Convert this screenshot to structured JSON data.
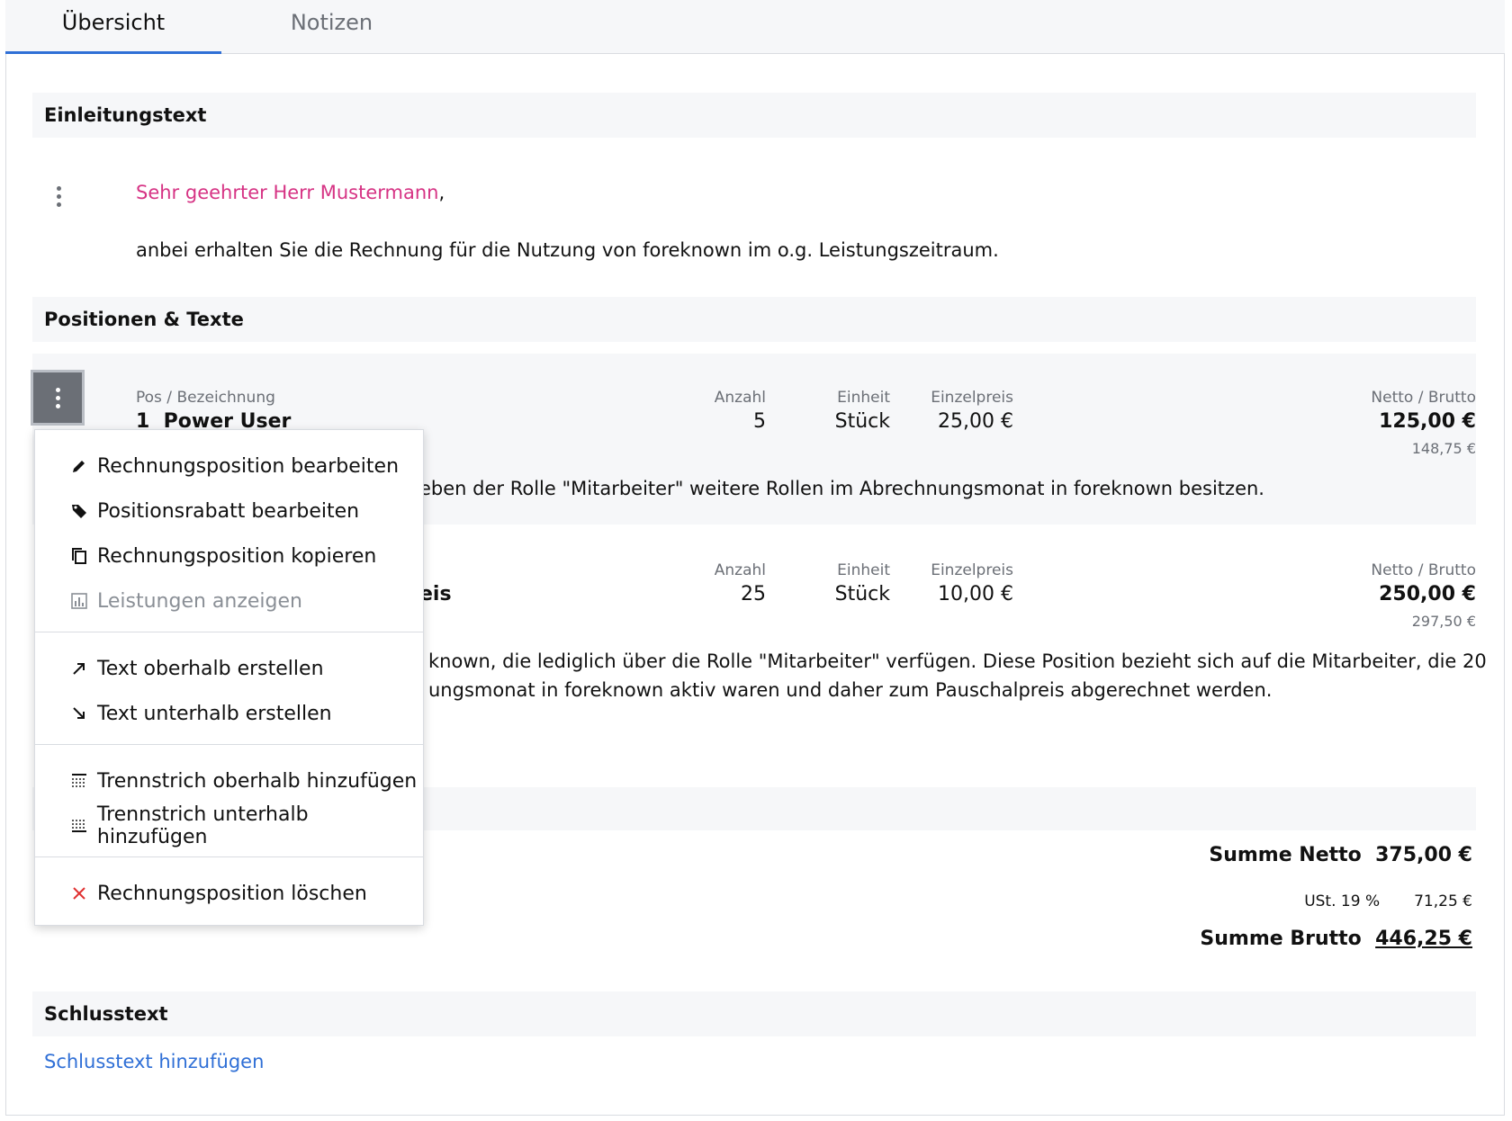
{
  "tabs": [
    {
      "label": "Übersicht"
    },
    {
      "label": "Notizen"
    }
  ],
  "intro_section": {
    "title": "Einleitungstext",
    "salutation_name": "Sehr geehrter Herr Mustermann",
    "salutation_punct": ",",
    "body": "anbei erhalten Sie die Rechnung für die Nutzung von foreknown im o.g. Leistungszeitraum."
  },
  "positions_section": {
    "title": "Positionen & Texte",
    "headers": {
      "pos": "Pos / Bezeichnung",
      "qty": "Anzahl",
      "unit": "Einheit",
      "price": "Einzelpreis",
      "total": "Netto / Brutto"
    },
    "items": [
      {
        "number": "1",
        "name": "Power User",
        "qty": "5",
        "unit": "Stück",
        "price": "25,00 €",
        "net": "125,00 €",
        "gross": "148,75 €",
        "desc_lines": [
          "eben der Rolle \"Mitarbeiter\" weitere Rollen im Abrechnungsmonat in foreknown besitzen."
        ]
      },
      {
        "name_fragment": "eis",
        "qty": "25",
        "unit": "Stück",
        "price": "10,00 €",
        "net": "250,00 €",
        "gross": "297,50 €",
        "desc_lines": [
          "known, die lediglich über die Rolle \"Mitarbeiter\" verfügen. Diese Position bezieht sich auf die Mitarbeiter, die 20",
          "ungsmonat in foreknown aktiv waren und daher zum Pauschalpreis abgerechnet werden."
        ]
      }
    ]
  },
  "totals": {
    "net_label": "Summe Netto",
    "net_value": "375,00 €",
    "tax_label": "USt. 19 %",
    "tax_value": "71,25 €",
    "gross_label": "Summe Brutto",
    "gross_value": "446,25 €"
  },
  "closing_section": {
    "title": "Schlusstext",
    "add_link": "Schlusstext hinzufügen"
  },
  "context_menu": {
    "items": [
      {
        "label": "Rechnungsposition bearbeiten",
        "icon": "pencil-icon"
      },
      {
        "label": "Positionsrabatt bearbeiten",
        "icon": "tag-icon"
      },
      {
        "label": "Rechnungsposition kopieren",
        "icon": "copy-icon"
      },
      {
        "label": "Leistungen anzeigen",
        "icon": "chart-icon",
        "disabled": true
      },
      {
        "label": "Text oberhalb erstellen",
        "icon": "arrow-up-right-icon"
      },
      {
        "label": "Text unterhalb erstellen",
        "icon": "arrow-down-right-icon"
      },
      {
        "label": "Trennstrich oberhalb hinzufügen",
        "icon": "divider-above-icon"
      },
      {
        "label": "Trennstrich unterhalb hinzufügen",
        "icon": "divider-below-icon"
      },
      {
        "label": "Rechnungsposition löschen",
        "icon": "close-icon"
      }
    ]
  },
  "colors": {
    "accent": "#2f6fd6",
    "salutation": "#d63384",
    "delete": "#e03131",
    "section_bg": "#f6f7f9"
  }
}
